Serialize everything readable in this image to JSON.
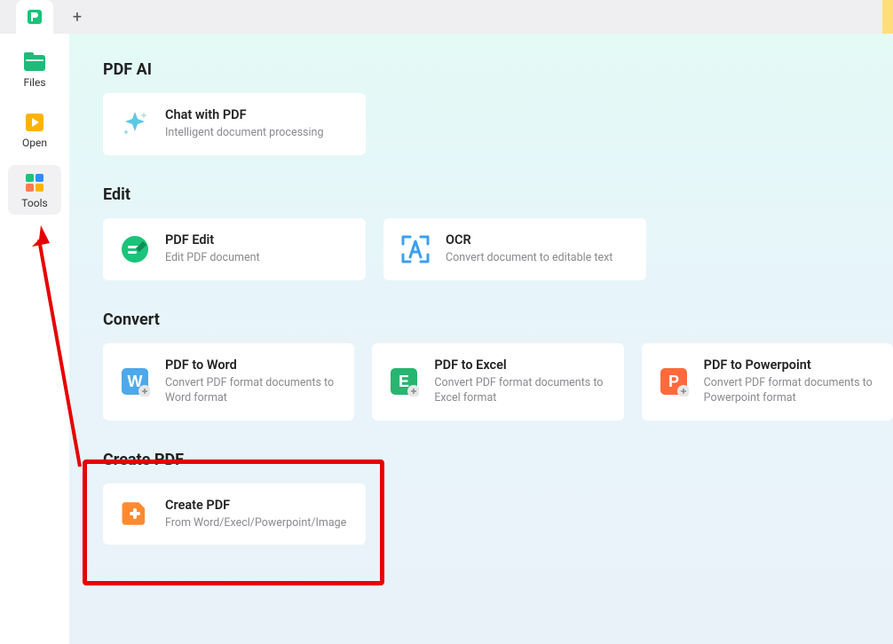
{
  "topbar": {
    "app_icon_name": "app-logo",
    "plus_label": "+"
  },
  "sidebar": {
    "items": [
      {
        "id": "files",
        "label": "Files",
        "icon": "files-icon",
        "active": false
      },
      {
        "id": "open",
        "label": "Open",
        "icon": "open-icon",
        "active": false
      },
      {
        "id": "tools",
        "label": "Tools",
        "icon": "tools-icon",
        "active": true
      }
    ]
  },
  "sections": {
    "pdf_ai": {
      "title": "PDF AI",
      "cards": [
        {
          "title": "Chat with PDF",
          "subtitle": "Intelligent document processing",
          "icon": "sparkle-icon"
        }
      ]
    },
    "edit": {
      "title": "Edit",
      "cards": [
        {
          "title": "PDF Edit",
          "subtitle": "Edit PDF document",
          "icon": "pdf-edit-icon"
        },
        {
          "title": "OCR",
          "subtitle": "Convert document to editable text",
          "icon": "ocr-icon"
        }
      ]
    },
    "convert": {
      "title": "Convert",
      "cards": [
        {
          "title": "PDF to Word",
          "subtitle": "Convert PDF format documents to Word format",
          "icon": "word-icon"
        },
        {
          "title": "PDF to Excel",
          "subtitle": "Convert PDF format documents to Excel format",
          "icon": "excel-icon"
        },
        {
          "title": "PDF to Powerpoint",
          "subtitle": "Convert PDF format documents to Powerpoint format",
          "icon": "powerpoint-icon"
        }
      ]
    },
    "create": {
      "title": "Create PDF",
      "cards": [
        {
          "title": "Create PDF",
          "subtitle": "From Word/Execl/Powerpoint/Image",
          "icon": "create-pdf-icon"
        }
      ]
    }
  },
  "annotations": {
    "highlight_target": "create-section",
    "arrow_points_to": "sidebar-item-tools"
  }
}
